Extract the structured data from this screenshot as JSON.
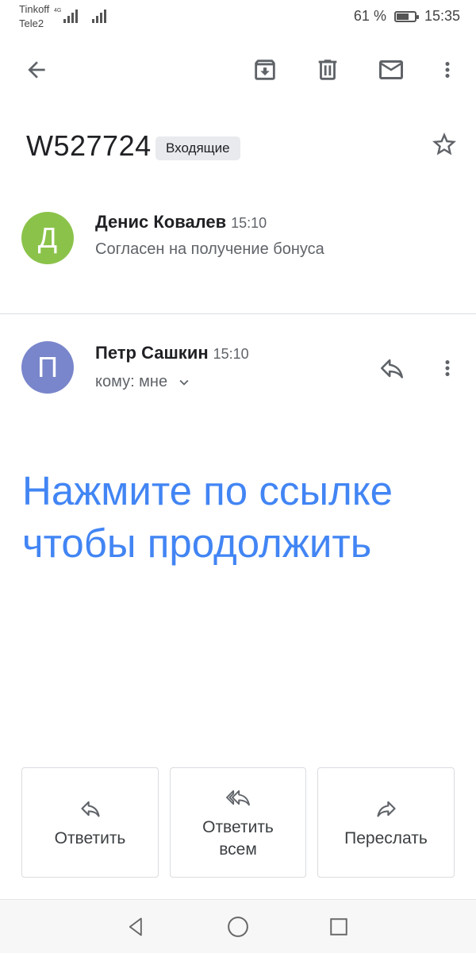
{
  "status_bar": {
    "carrier1": "Tinkoff",
    "carrier2": "Tele2",
    "network": "4G",
    "battery": "61 %",
    "battery_level": 0.61,
    "time": "15:35"
  },
  "toolbar": {
    "back": "arrow-back-icon",
    "archive": "archive-icon",
    "delete": "trash-icon",
    "mark_unread": "mail-icon",
    "more": "more-vert-icon"
  },
  "thread": {
    "subject": "W527724",
    "label": "Входящие",
    "starred": false
  },
  "messages": [
    {
      "avatar_letter": "Д",
      "avatar_color": "#8bc34a",
      "sender": "Денис Ковалев",
      "time": "15:10",
      "snippet": "Согласен на получение бонуса"
    },
    {
      "avatar_letter": "П",
      "avatar_color": "#7986cb",
      "sender": "Петр Сашкин",
      "time": "15:10",
      "recipient": "кому: мне",
      "body_line1": "Нажмите по ссылке",
      "body_line2": "чтобы продолжить",
      "body_color": "#4285f4"
    }
  ],
  "actions": {
    "reply": "Ответить",
    "reply_all_line1": "Ответить",
    "reply_all_line2": "всем",
    "forward": "Переслать"
  }
}
